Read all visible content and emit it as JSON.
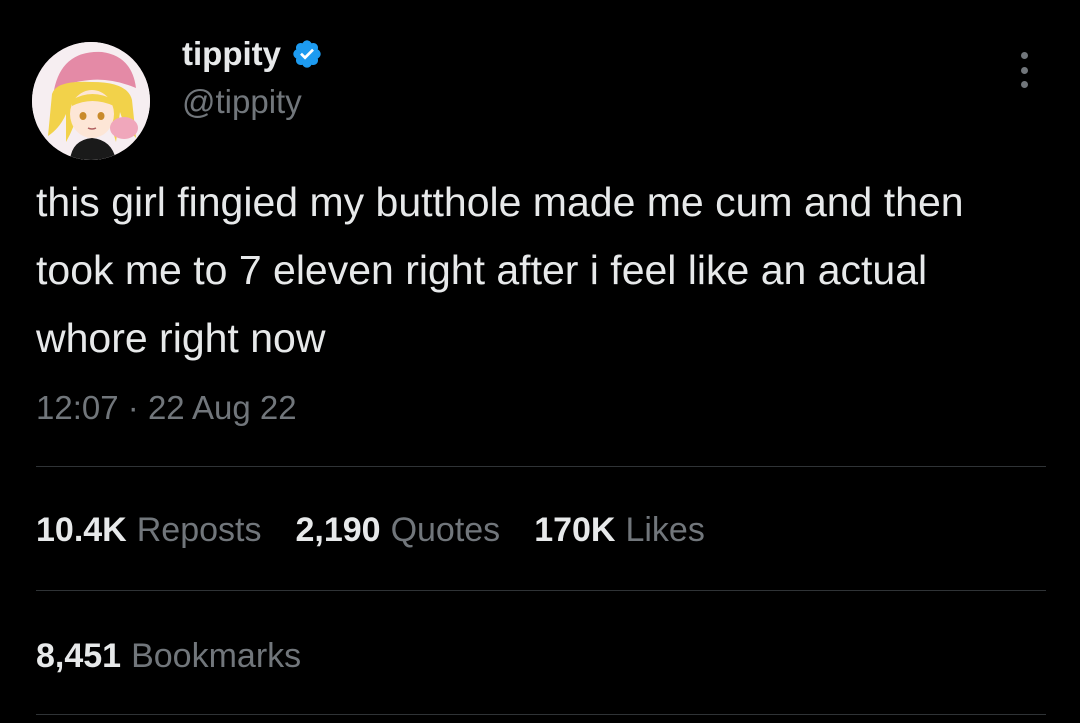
{
  "author": {
    "display_name": "tippity",
    "handle": "@tippity",
    "verified_icon": "verified-badge-icon",
    "avatar_icon": "anime-girl-avatar"
  },
  "tweet": {
    "text": "this girl fingied my butthole made me cum and then took me to 7 eleven right after i feel like an actual whore right now",
    "time": "12:07",
    "separator": "·",
    "date": "22 Aug 22"
  },
  "stats": {
    "reposts": {
      "count": "10.4K",
      "label": "Reposts"
    },
    "quotes": {
      "count": "2,190",
      "label": "Quotes"
    },
    "likes": {
      "count": "170K",
      "label": "Likes"
    },
    "bookmarks": {
      "count": "8,451",
      "label": "Bookmarks"
    }
  },
  "colors": {
    "background": "#000000",
    "primary_text": "#e7e9ea",
    "secondary_text": "#71767b",
    "divider": "#2f3336",
    "verified": "#1d9bf0"
  }
}
